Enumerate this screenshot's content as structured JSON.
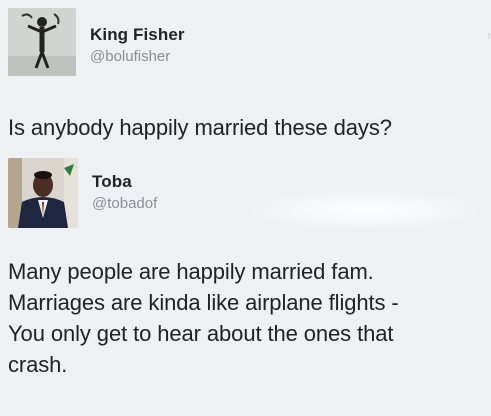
{
  "tweet1": {
    "display_name": "King Fisher",
    "handle": "@bolufisher",
    "avatar_icon": "skeleton-figure-avatar",
    "text": "Is anybody happily married these days?"
  },
  "tweet2": {
    "display_name": "Toba",
    "handle": "@tobadof",
    "avatar_icon": "man-in-suit-avatar",
    "text_lines": [
      "Many people are happily married fam.",
      "Marriages are kinda like airplane flights -",
      "You only get to hear about the ones that",
      "crash."
    ]
  },
  "colors": {
    "background": "#eef1f4",
    "text": "#222222",
    "handle": "#8a8f95"
  }
}
